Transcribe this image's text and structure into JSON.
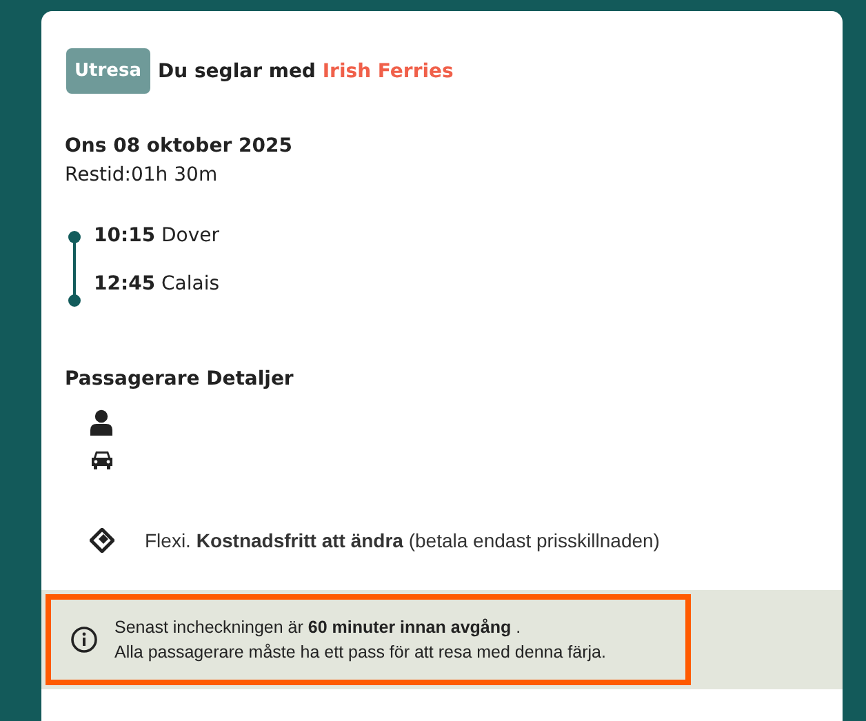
{
  "header": {
    "badge": "Utresa",
    "title": "Du seglar med **Irish Ferries**"
  },
  "date": "Ons 08 oktober 2025",
  "duration": "Restid:01h 30m",
  "stops": [
    {
      "time": "10:15",
      "place": "Dover"
    },
    {
      "time": "12:45",
      "place": "Calais"
    }
  ],
  "passengers": {
    "heading": "Passagerare Detaljer",
    "items": [
      {
        "kind": "person"
      },
      {
        "kind": "car"
      }
    ]
  },
  "ticket": {
    "text": "Flexi. **Kostnadsfritt att ändra** (betala endast prisskillnaden)"
  },
  "notice": {
    "highlighted": true,
    "lines": [
      "Senast incheckningen är **60 minuter innan avgång** .",
      "Alla passagerare måste ha ett pass för att resa med denna färja."
    ]
  }
}
